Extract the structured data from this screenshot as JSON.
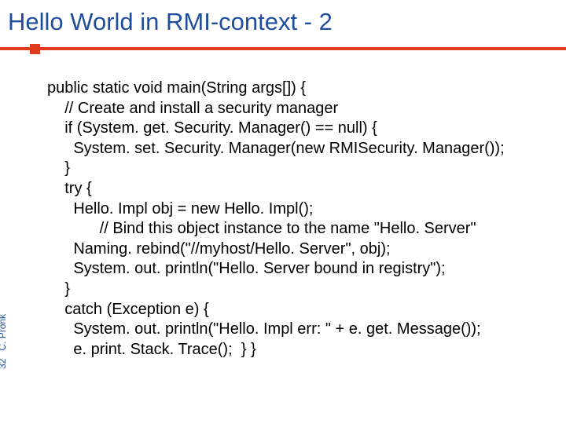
{
  "title": "Hello World in RMI-context - 2",
  "code": {
    "l1": "public static void main(String args[]) {",
    "l2": "    // Create and install a security manager",
    "l3": "    if (System. get. Security. Manager() == null) {",
    "l4": "      System. set. Security. Manager(new RMISecurity. Manager());",
    "l5": "    }",
    "l6": "    try {",
    "l7": "      Hello. Impl obj = new Hello. Impl();",
    "l8": "            // Bind this object instance to the name \"Hello. Server\"",
    "l9": "      Naming. rebind(\"//myhost/Hello. Server\", obj);",
    "l10": "      System. out. println(\"Hello. Server bound in registry\");",
    "l11": "    }",
    "l12": "    catch (Exception e) {",
    "l13": "      System. out. println(\"Hello. Impl err: \" + e. get. Message());",
    "l14": "      e. print. Stack. Trace();  } }"
  },
  "footer": {
    "page": "32",
    "author": "C. Pronk"
  }
}
